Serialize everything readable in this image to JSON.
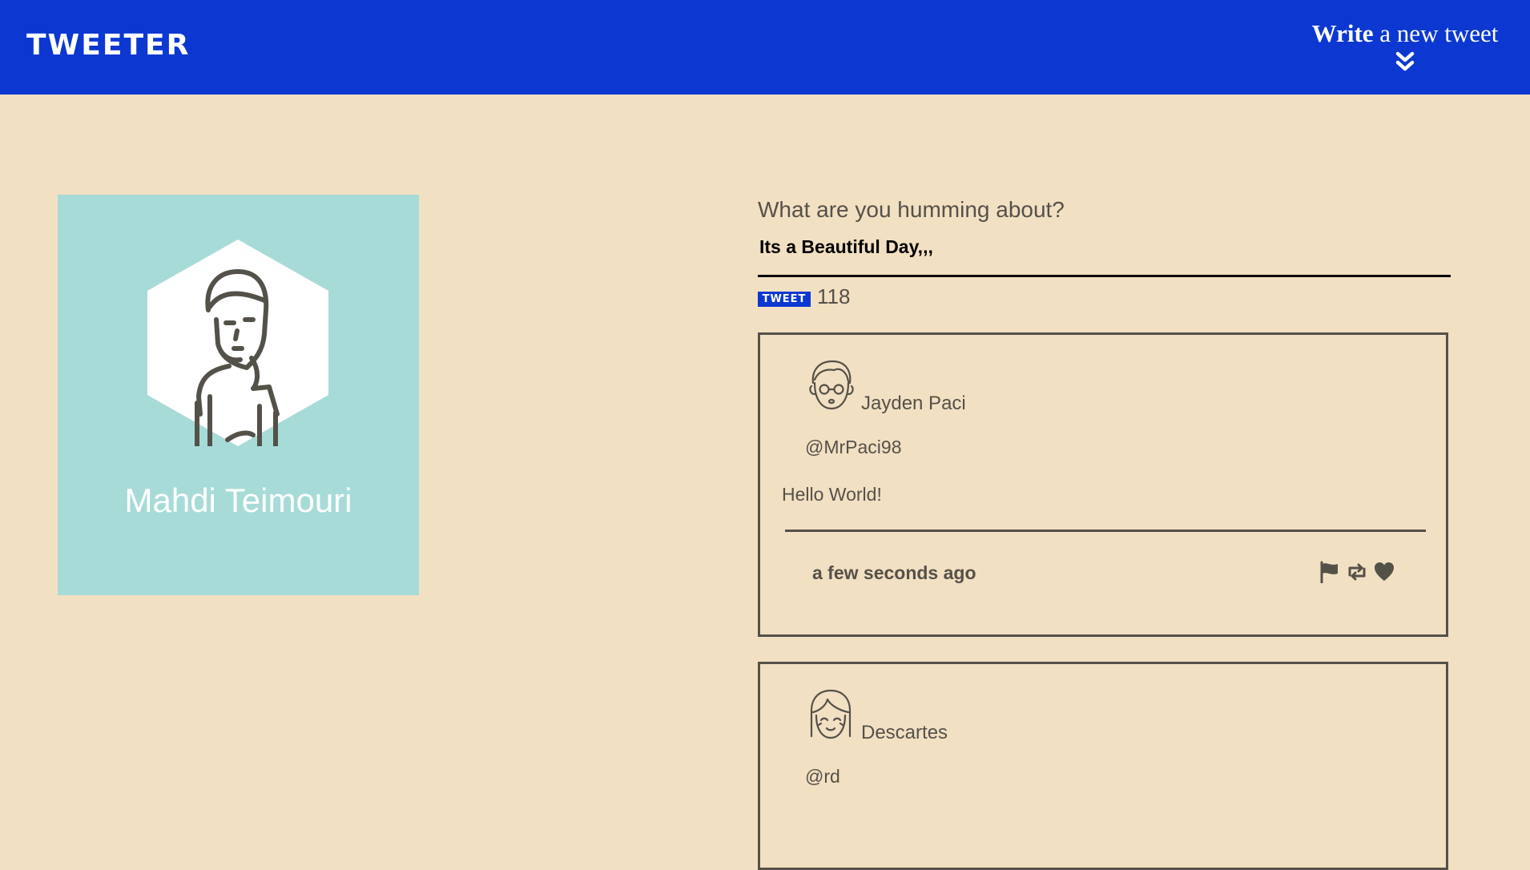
{
  "header": {
    "brand": "TWEETER",
    "compose_bold": "Write",
    "compose_rest": " a new tweet",
    "compose_icon": "double-chevron-down-icon",
    "background_color": "#0c38d1"
  },
  "profile": {
    "name": "Mahdi Teimouri",
    "avatar_icon": "woman-avatar-icon",
    "card_color": "#a7dbd8"
  },
  "composer": {
    "label": "What are you humming about?",
    "value": "Its a Beautiful Day,,,",
    "button_label": "TWEET",
    "char_count": "118"
  },
  "tweets": [
    {
      "name": "Jayden Paci",
      "handle": "@MrPaci98",
      "content": "Hello World!",
      "time": "a few seconds ago",
      "avatar_icon": "man-glasses-avatar-icon"
    },
    {
      "name": "Descartes",
      "handle": "@rd",
      "content": "",
      "time": "",
      "avatar_icon": "woman-bangs-avatar-icon"
    }
  ],
  "action_icons": [
    "flag-icon",
    "retweet-icon",
    "heart-icon"
  ],
  "page_background": "#f2e0c2"
}
